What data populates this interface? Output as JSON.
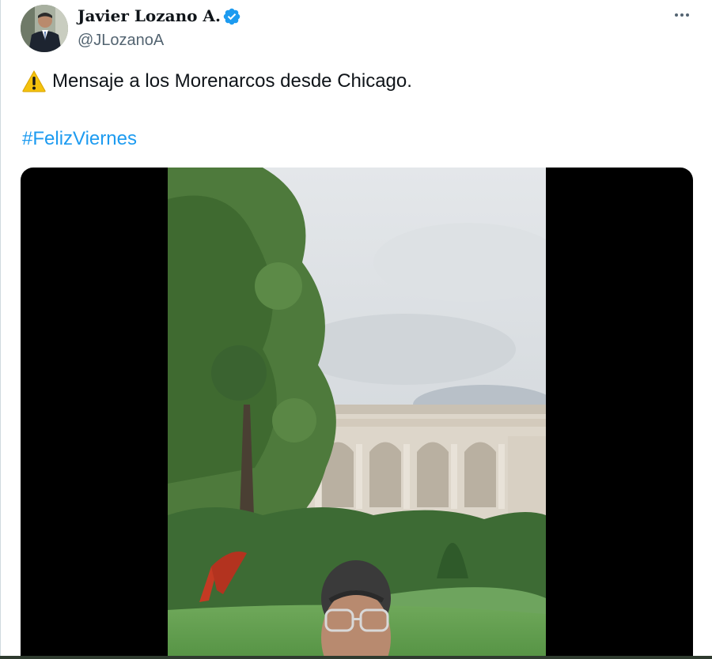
{
  "tweet": {
    "author": {
      "display_name": "Javier Lozano A.",
      "handle": "@JLozanoA",
      "verified": true,
      "verified_color": "#1d9bf0",
      "avatar_icon": "profile-photo"
    },
    "text": "Mensaje a los Morenarcos desde Chicago.",
    "leading_emoji": "warning-icon",
    "hashtag": "#FelizViernes",
    "hashtag_color": "#1d9bf0",
    "more_icon": "more-horizontal-icon",
    "media": {
      "type": "video",
      "description_icon": "video-thumbnail"
    }
  }
}
